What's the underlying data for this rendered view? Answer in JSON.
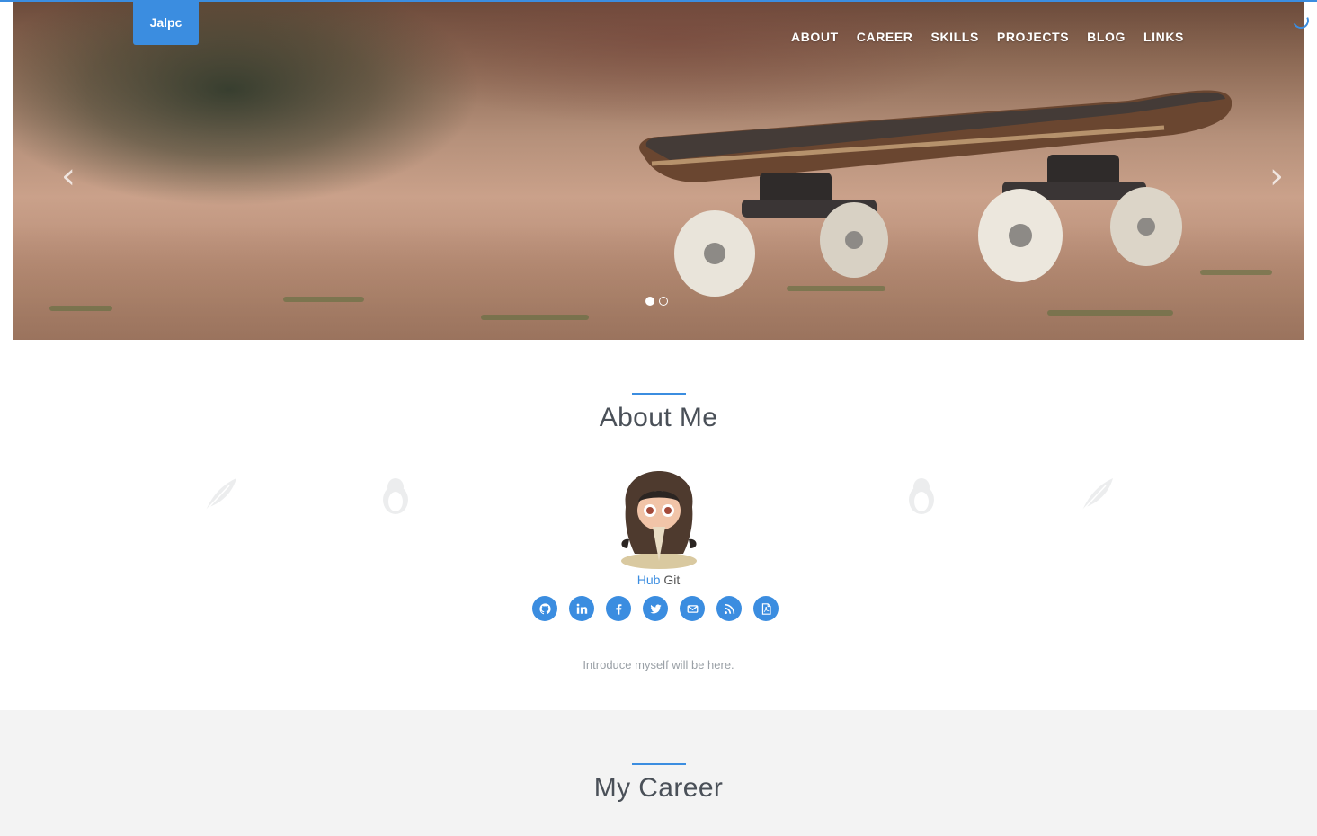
{
  "brand": {
    "label": "Jalpc"
  },
  "nav": {
    "items": [
      {
        "label": "ABOUT"
      },
      {
        "label": "CAREER"
      },
      {
        "label": "SKILLS"
      },
      {
        "label": "PROJECTS"
      },
      {
        "label": "BLOG"
      },
      {
        "label": "LINKS"
      }
    ]
  },
  "carousel": {
    "prev_icon": "chevron-left-icon",
    "next_icon": "chevron-right-icon",
    "slide_count": 2,
    "active_slide": 1
  },
  "about": {
    "title": "About Me",
    "name_blue": "Hub",
    "name_rest": " Git",
    "intro": "Introduce myself will be here.",
    "socials": [
      {
        "icon": "github-icon"
      },
      {
        "icon": "linkedin-icon"
      },
      {
        "icon": "facebook-icon"
      },
      {
        "icon": "twitter-icon"
      },
      {
        "icon": "envelope-icon"
      },
      {
        "icon": "rss-icon"
      },
      {
        "icon": "pdf-icon"
      }
    ]
  },
  "career": {
    "title": "My Career"
  },
  "colors": {
    "accent": "#3b8de0",
    "text": "#4a5058",
    "muted": "#9aa0a6",
    "section_bg": "#f3f3f3"
  }
}
